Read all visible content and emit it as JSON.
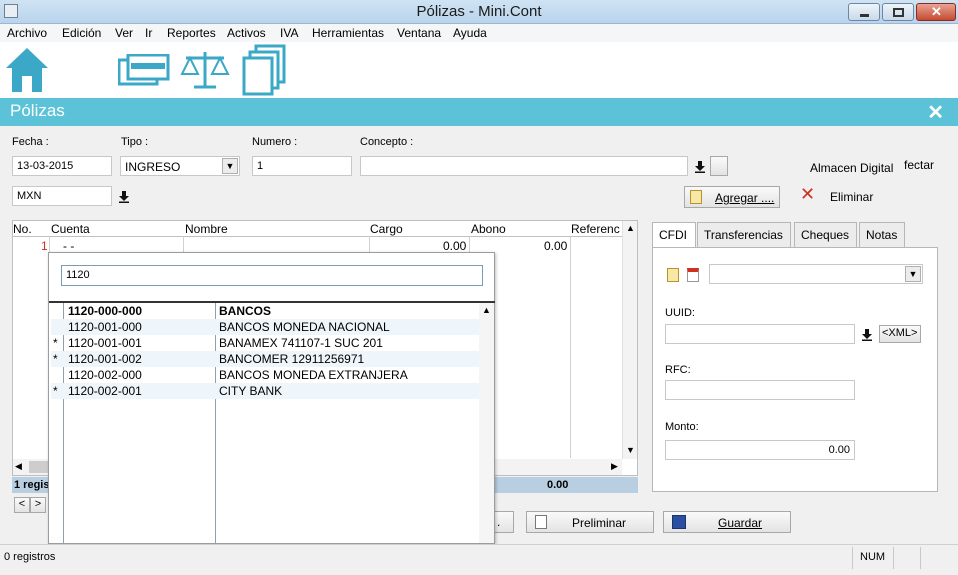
{
  "window": {
    "title": "Pólizas - Mini.Cont"
  },
  "menu": [
    "Archivo",
    "Edición",
    "Ver",
    "Ir",
    "Reportes",
    "Activos",
    "IVA",
    "Herramientas",
    "Ventana",
    "Ayuda"
  ],
  "toolbar": {
    "icons": [
      "home-icon",
      "cards-icon",
      "balance-icon",
      "documents-icon"
    ]
  },
  "section": {
    "title": "Pólizas"
  },
  "form": {
    "fecha_label": "Fecha :",
    "fecha_value": "13-03-2015",
    "tipo_label": "Tipo :",
    "tipo_value": "INGRESO",
    "numero_label": "Numero :",
    "numero_value": "1",
    "concepto_label": "Concepto :",
    "concepto_value": "",
    "moneda_value": "MXN",
    "almacen_label": "Almacen Digital",
    "fectar_label": "fectar",
    "agregar_label": "Agregar ....",
    "eliminar_label": "Eliminar"
  },
  "grid": {
    "columns": [
      "No.",
      "Cuenta",
      "Nombre",
      "Cargo",
      "Abono",
      "Referenc"
    ],
    "row": {
      "no": "1",
      "cuenta": "-  -",
      "cargo": "0.00",
      "abono": "0.00"
    },
    "footer_count": "1 regis",
    "footer_total": "0.00",
    "nav_prev": "<",
    "nav_next": ">"
  },
  "tabs": [
    "CFDI",
    "Transferencias",
    "Cheques",
    "Notas"
  ],
  "cfdi": {
    "uuid_label": "UUID:",
    "xml_button": "<XML>",
    "rfc_label": "RFC:",
    "monto_label": "Monto:",
    "monto_value": "0.00"
  },
  "popup": {
    "search_value": "1120",
    "rows": [
      {
        "mark": "",
        "code": "1120-000-000",
        "name": "BANCOS",
        "bold": true
      },
      {
        "mark": "",
        "code": "1120-001-000",
        "name": "BANCOS MONEDA NACIONAL",
        "bold": false
      },
      {
        "mark": "*",
        "code": "1120-001-001",
        "name": "BANAMEX 741107-1 SUC 201",
        "bold": false
      },
      {
        "mark": "*",
        "code": "1120-001-002",
        "name": "BANCOMER 12911256971",
        "bold": false
      },
      {
        "mark": "",
        "code": "1120-002-000",
        "name": "BANCOS MONEDA EXTRANJERA",
        "bold": false
      },
      {
        "mark": "*",
        "code": "1120-002-001",
        "name": "CITY BANK",
        "bold": false
      }
    ]
  },
  "actions": {
    "preliminar_label": "Preliminar",
    "guardar_label": "Guardar",
    "hidden_button_label": "."
  },
  "status": {
    "left": "0 registros",
    "num": "NUM"
  },
  "colors": {
    "section": "#5bc2d8",
    "accent_red": "#d03020",
    "toolbar_icon": "#3aa8c6"
  }
}
